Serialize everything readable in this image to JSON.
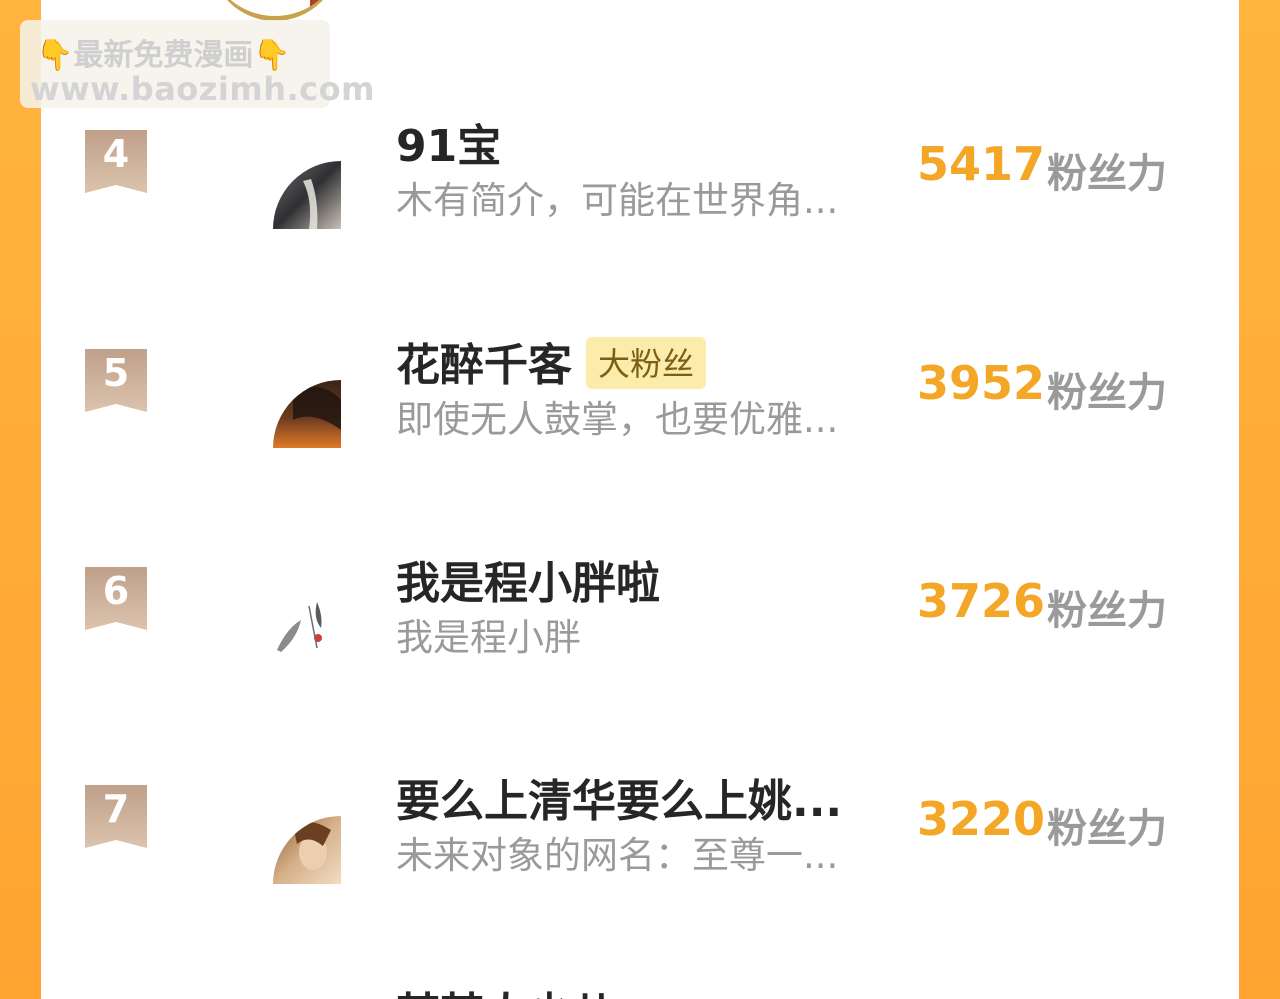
{
  "watermark": {
    "line1": "👇最新免费漫画👇",
    "line2": "www.baozimh.com"
  },
  "rank_label_suffix": "粉丝力",
  "entries": [
    {
      "rank": "4",
      "name": "91宝",
      "badge": "",
      "desc": "木有简介，可能在世界角...",
      "score": "5417",
      "score_label": "粉丝力"
    },
    {
      "rank": "5",
      "name": "花醉千客",
      "badge": "大粉丝",
      "desc": "即使无人鼓掌，也要优雅...",
      "score": "3952",
      "score_label": "粉丝力"
    },
    {
      "rank": "6",
      "name": "我是程小胖啦",
      "badge": "",
      "desc": "我是程小胖",
      "score": "3726",
      "score_label": "粉丝力"
    },
    {
      "rank": "7",
      "name": "要么上清华要么上姚...",
      "badge": "",
      "desc": "未来对象的网名：至尊一...",
      "score": "3220",
      "score_label": "粉丝力"
    }
  ],
  "next_entry_name": "某某人少儿",
  "colors": {
    "side_orange": "#ffa431",
    "score_orange": "#f4a626",
    "rank_badge": "#c9a892",
    "fan_badge_bg": "#fcecab"
  }
}
